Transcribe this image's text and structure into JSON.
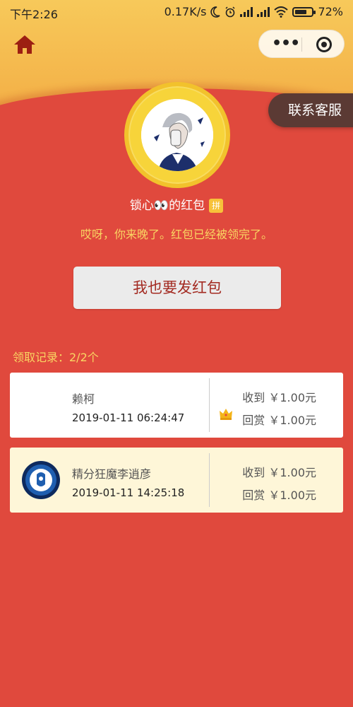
{
  "status_bar": {
    "time": "下午2:26",
    "net_speed": "0.17K/s",
    "battery": "72%",
    "battery_level": 0.72
  },
  "nav": {
    "home_icon": "home-icon",
    "menu_icon": "more-dots-icon",
    "close_icon": "target-icon"
  },
  "contact_label": "联系客服",
  "sender": {
    "text": "锁心👀的红包",
    "pin_badge": "拼"
  },
  "late_message": "哎呀，你来晚了。红包已经被领完了。",
  "send_button_label": "我也要发红包",
  "records": {
    "title": "领取记录：2/2个",
    "items": [
      {
        "name": "赖柯",
        "time": "2019-01-11 06:24:47",
        "received": "收到 ￥1.00元",
        "reward": "回赏 ￥1.00元",
        "crown": true
      },
      {
        "name": "精分狂魔李逍彦",
        "time": "2019-01-11 14:25:18",
        "received": "收到 ￥1.00元",
        "reward": "回赏 ￥1.00元",
        "crown": false
      }
    ]
  },
  "colors": {
    "background_red": "#e0493d",
    "gold_text": "#f9d562",
    "contact_bg": "#5b3a34",
    "button_text": "#a32b22"
  }
}
